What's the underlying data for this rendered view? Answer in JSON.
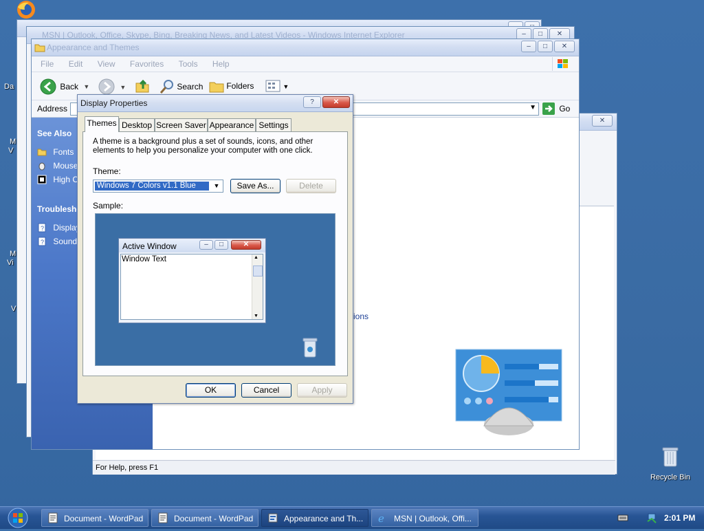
{
  "desktop": {
    "recycle_bin_label": "Recycle Bin",
    "left_edge_labels": [
      "Da",
      "M",
      "V",
      "M",
      "Vi",
      "V"
    ]
  },
  "msn_window": {
    "title": "MSN | Outlook, Office, Skype, Bing, Breaking News, and Latest Videos - Windows Internet Explorer"
  },
  "wordpad_window": {
    "status": "For Help, press F1"
  },
  "explorer": {
    "title": "Appearance and Themes",
    "menu": [
      "File",
      "Edit",
      "View",
      "Favorites",
      "Tools",
      "Help"
    ],
    "toolbar": {
      "back": "Back",
      "search": "Search",
      "folders": "Folders"
    },
    "address_label": "Address",
    "go_label": "Go",
    "see_also_header": "See Also",
    "see_also_items": [
      "Fonts",
      "Mouse",
      "High C"
    ],
    "troubleshooters_header": "Troublesho",
    "troubleshooter_items": [
      "Display",
      "Sound"
    ],
    "partial_link": "ions"
  },
  "dialog": {
    "title": "Display Properties",
    "help_btn": "?",
    "tabs": [
      "Themes",
      "Desktop",
      "Screen Saver",
      "Appearance",
      "Settings"
    ],
    "description": "A theme is a background plus a set of sounds, icons, and other elements to help you personalize your computer with one click.",
    "theme_label": "Theme:",
    "theme_value": "Windows 7 Colors v1.1 Blue",
    "save_as": "Save As...",
    "delete": "Delete",
    "sample_label": "Sample:",
    "preview": {
      "active_window": "Active Window",
      "window_text": "Window Text"
    },
    "ok": "OK",
    "cancel": "Cancel",
    "apply": "Apply"
  },
  "taskbar": {
    "items": [
      {
        "label": "Document - WordPad",
        "icon": "wordpad-icon"
      },
      {
        "label": "Document - WordPad",
        "icon": "wordpad-icon"
      },
      {
        "label": "Appearance and Th...",
        "icon": "explorer-icon"
      },
      {
        "label": "MSN | Outlook, Offi...",
        "icon": "ie-icon"
      }
    ],
    "clock": "2:01 PM"
  },
  "colors": {
    "desktop": "#3a6ea5",
    "sidebar": "#4c78c9",
    "taskbar": "#285595",
    "selection": "#316ac5"
  }
}
